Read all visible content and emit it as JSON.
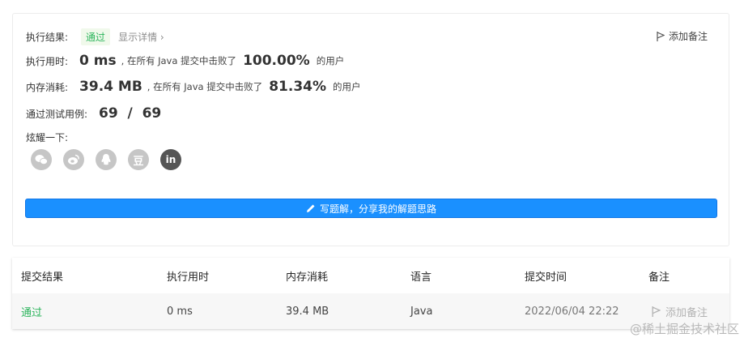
{
  "result": {
    "label": "执行结果:",
    "status": "通过",
    "detail_link": "显示详情 ›",
    "add_note": "添加备注"
  },
  "runtime": {
    "label": "执行用时:",
    "value": "0 ms",
    "middle": ", 在所有 Java 提交中击败了",
    "percent": "100.00%",
    "suffix": "的用户"
  },
  "memory": {
    "label": "内存消耗:",
    "value": "39.4 MB",
    "middle": ", 在所有 Java 提交中击败了",
    "percent": "81.34%",
    "suffix": "的用户"
  },
  "tests": {
    "label": "通过测试用例:",
    "value": "69  /  69"
  },
  "share": {
    "label": "炫耀一下:",
    "icons": [
      "wechat-icon",
      "weibo-icon",
      "qq-icon",
      "douban-icon",
      "linkedin-icon"
    ],
    "douban_glyph": "豆",
    "linkedin_glyph": "in"
  },
  "solution_button": "写题解，分享我的解题思路",
  "table": {
    "headers": [
      "提交结果",
      "执行用时",
      "内存消耗",
      "语言",
      "提交时间",
      "备注"
    ],
    "row": {
      "result": "通过",
      "runtime": "0 ms",
      "memory": "39.4 MB",
      "language": "Java",
      "time": "2022/06/04 22:22",
      "note": "添加备注"
    }
  },
  "colors": {
    "success": "#2db55d",
    "primary": "#1a90ff"
  },
  "watermark": "@稀土掘金技术社区"
}
